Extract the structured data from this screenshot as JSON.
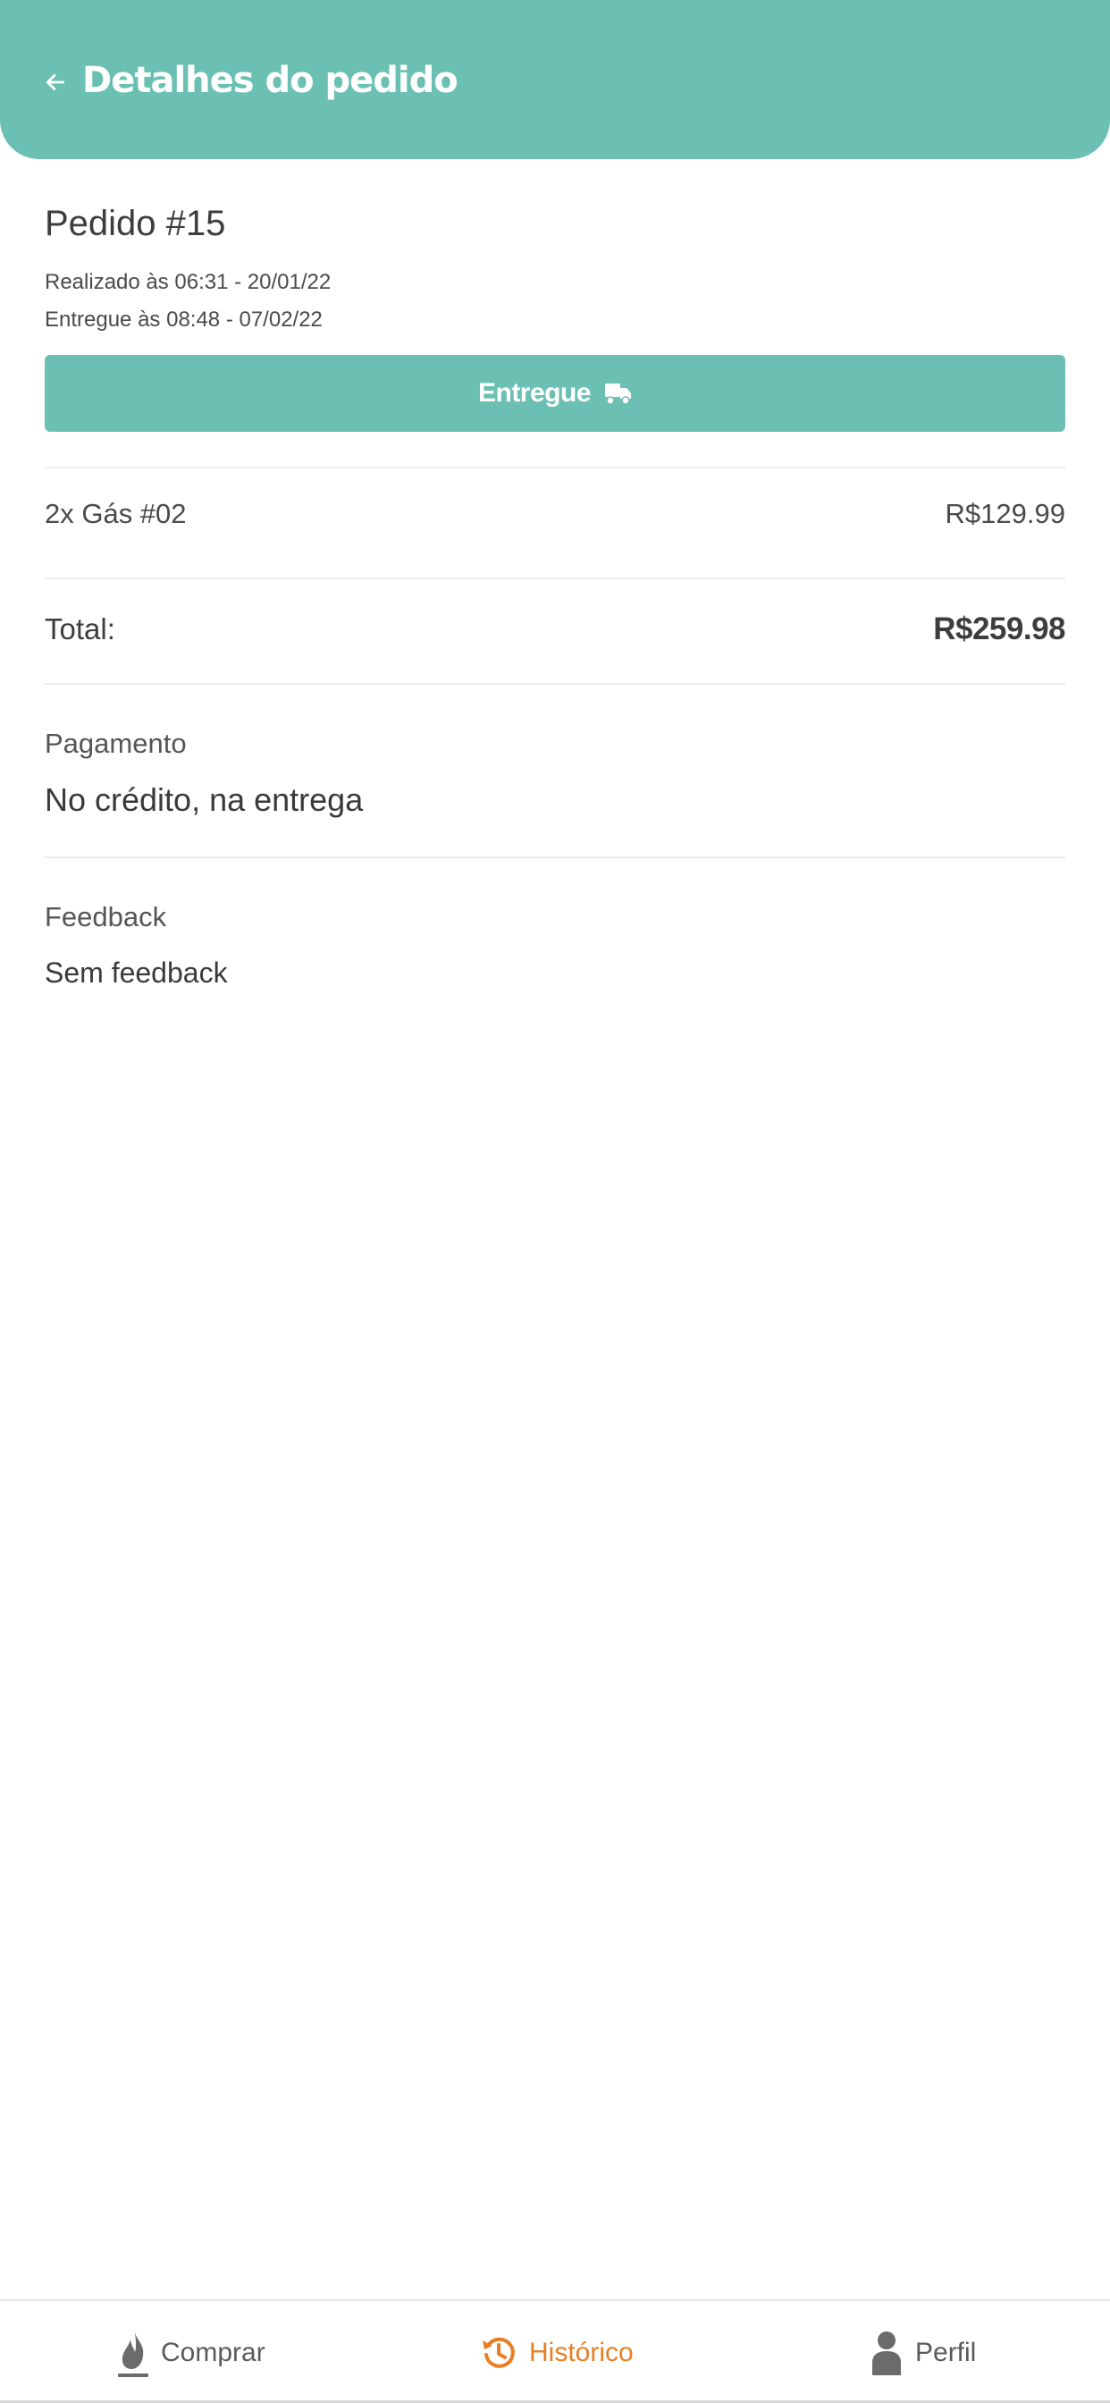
{
  "header": {
    "title": "Detalhes do pedido",
    "back_icon": "arrow-left-icon"
  },
  "order": {
    "title": "Pedido #15",
    "placed_at": "Realizado às 06:31 - 20/01/22",
    "delivered_at": "Entregue às 08:48 - 07/02/22",
    "status_label": "Entregue",
    "status_icon": "truck-icon"
  },
  "items": [
    {
      "name": "2x Gás #02",
      "price": "R$129.99"
    }
  ],
  "total": {
    "label": "Total:",
    "value": "R$259.98"
  },
  "payment": {
    "label": "Pagamento",
    "value": "No crédito, na entrega"
  },
  "feedback": {
    "label": "Feedback",
    "value": "Sem feedback"
  },
  "tabbar": {
    "tabs": [
      {
        "label": "Comprar",
        "icon": "flame-icon",
        "active": false
      },
      {
        "label": "Histórico",
        "icon": "history-icon",
        "active": true
      },
      {
        "label": "Perfil",
        "icon": "person-icon",
        "active": false
      }
    ]
  },
  "colors": {
    "primary": "#6cc0b3",
    "accent": "#e87f24",
    "text": "#3d3d3d",
    "icon_inactive": "#6b6b6b"
  }
}
